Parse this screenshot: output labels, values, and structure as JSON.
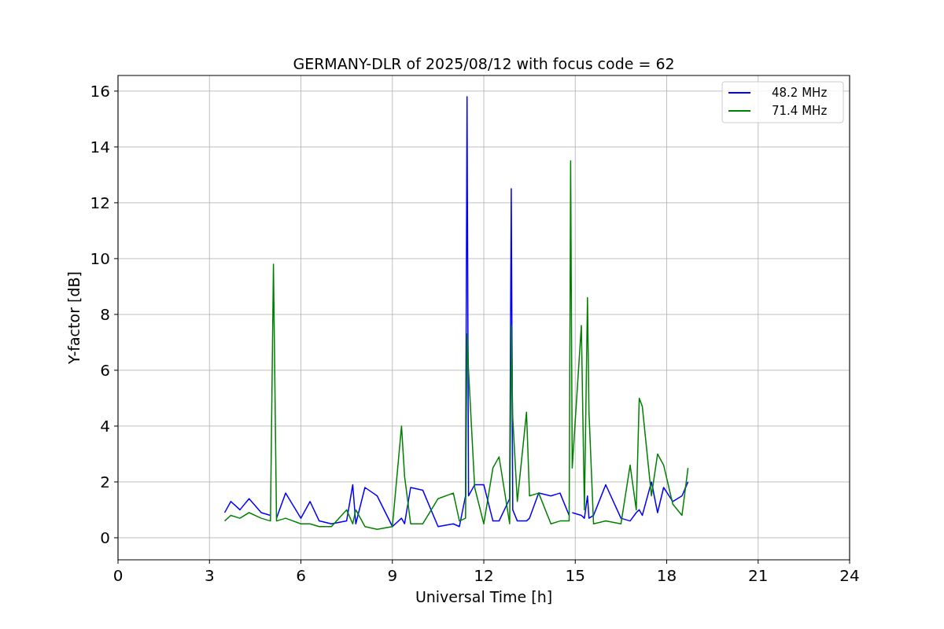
{
  "figure": {
    "chart_data": {
      "type": "line",
      "title": "GERMANY-DLR of 2025/08/12 with focus code = 62",
      "xlabel": "Universal Time [h]",
      "ylabel": "Y-factor [dB]",
      "x": [
        3.5,
        3.7,
        4.0,
        4.3,
        4.7,
        5.0,
        5.1,
        5.2,
        5.5,
        6.0,
        6.3,
        6.6,
        7.0,
        7.5,
        7.7,
        7.8,
        8.1,
        8.5,
        9.0,
        9.3,
        9.4,
        9.6,
        10.0,
        10.5,
        11.0,
        11.2,
        11.4,
        11.45,
        11.5,
        11.7,
        12.0,
        12.3,
        12.5,
        12.85,
        12.9,
        12.95,
        13.1,
        13.4,
        13.5,
        13.8,
        14.2,
        14.5,
        14.8,
        14.85,
        14.9,
        15.2,
        15.3,
        15.4,
        15.45,
        15.6,
        16.0,
        16.5,
        16.8,
        17.0,
        17.1,
        17.2,
        17.5,
        17.7,
        17.9,
        18.2,
        18.5,
        18.7
      ],
      "series": [
        {
          "name": "48.2 MHz",
          "color": "#0000ff",
          "values": [
            0.9,
            1.3,
            1.0,
            1.4,
            0.9,
            0.8,
            null,
            0.7,
            1.6,
            0.7,
            1.3,
            0.6,
            0.5,
            0.6,
            1.9,
            0.5,
            1.8,
            1.5,
            0.4,
            0.7,
            0.5,
            1.8,
            1.7,
            0.4,
            0.5,
            0.4,
            1.5,
            15.8,
            1.5,
            1.9,
            1.9,
            0.6,
            0.6,
            1.4,
            12.5,
            1.0,
            0.6,
            0.6,
            0.7,
            1.6,
            1.5,
            1.6,
            0.8,
            null,
            0.9,
            0.8,
            0.7,
            1.5,
            0.7,
            0.8,
            1.9,
            0.7,
            0.6,
            0.9,
            1.0,
            0.8,
            2.0,
            0.9,
            1.8,
            1.3,
            1.5,
            2.0
          ]
        },
        {
          "name": "71.4 MHz",
          "color": "#008000",
          "values": [
            0.6,
            0.8,
            0.7,
            0.9,
            0.7,
            0.6,
            9.8,
            0.6,
            0.7,
            0.5,
            0.5,
            0.4,
            0.4,
            1.0,
            0.5,
            1.0,
            0.4,
            0.3,
            0.4,
            4.0,
            2.2,
            0.5,
            0.5,
            1.4,
            1.6,
            0.6,
            0.7,
            7.3,
            6.0,
            1.8,
            0.5,
            2.5,
            2.9,
            0.5,
            7.6,
            4.3,
            1.3,
            4.5,
            1.5,
            1.6,
            0.5,
            0.6,
            0.6,
            13.5,
            2.5,
            7.6,
            1.0,
            8.6,
            4.5,
            0.5,
            0.6,
            0.5,
            2.6,
            1.0,
            5.0,
            4.7,
            1.5,
            3.0,
            2.6,
            1.2,
            0.8,
            2.5
          ]
        }
      ],
      "xlim": [
        0,
        24
      ],
      "ylim": [
        -0.79,
        16.56
      ],
      "xticks": [
        0,
        3,
        6,
        9,
        12,
        15,
        18,
        21,
        24
      ],
      "yticks": [
        0,
        2,
        4,
        6,
        8,
        10,
        12,
        14,
        16
      ],
      "grid": true,
      "legend": true
    }
  }
}
